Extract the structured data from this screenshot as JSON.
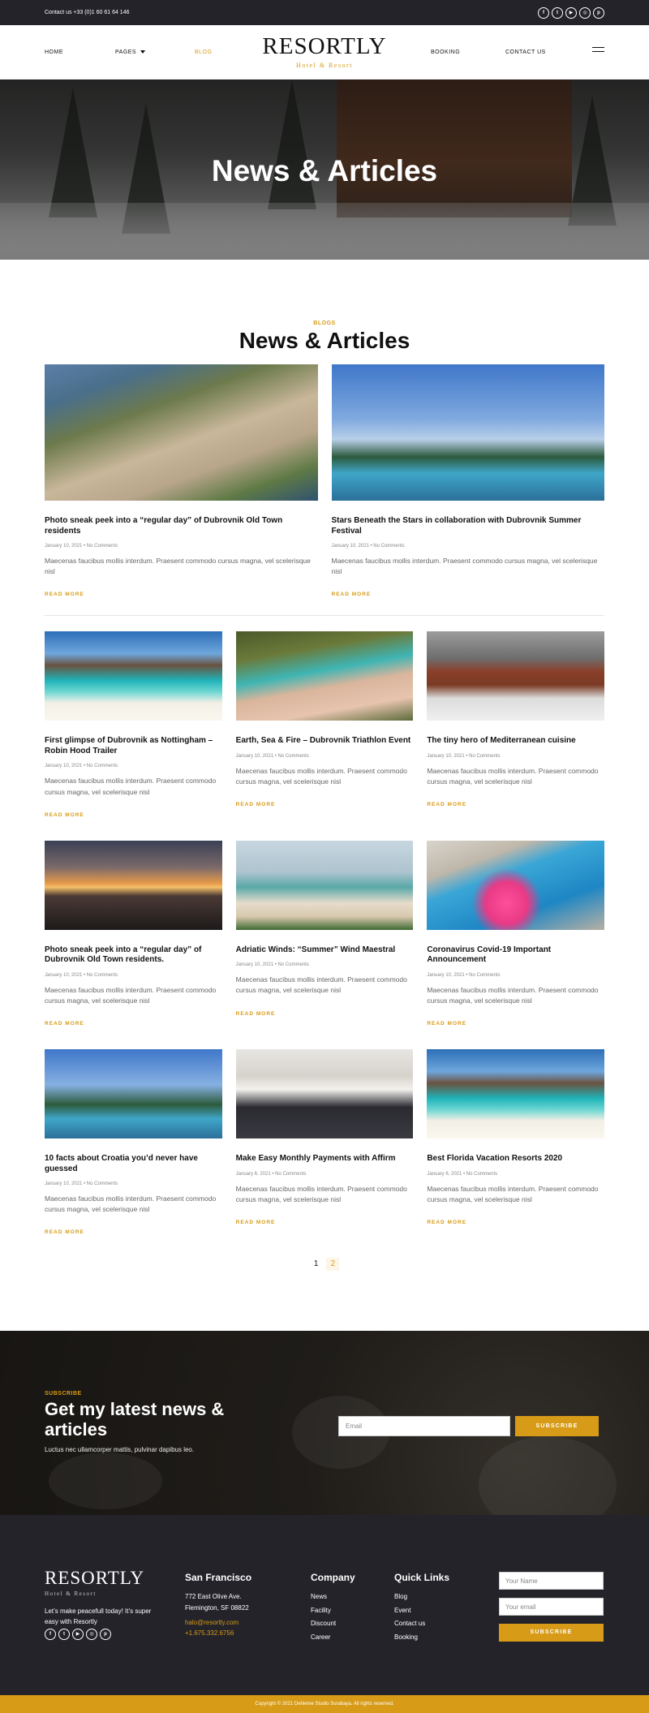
{
  "topbar": {
    "contact": "Contact us +33 (0)1 60 61 64 146",
    "social": [
      "facebook-icon",
      "twitter-icon",
      "youtube-icon",
      "instagram-icon",
      "pinterest-icon"
    ]
  },
  "nav": {
    "home": "HOME",
    "pages": "PAGES",
    "blog": "BLOG",
    "booking": "BOOKING",
    "contact": "CONTACT US"
  },
  "logo": {
    "name": "RESORTLY",
    "tagline": "Hotel & Resort"
  },
  "hero": {
    "title": "News & Articles"
  },
  "section": {
    "kicker": "BLOGS",
    "title": "News & Articles"
  },
  "featured": [
    {
      "title": "Photo sneak peek into a “regular day” of Dubrovnik Old Town residents",
      "meta": "January 10, 2021 • No Comments",
      "excerpt": "Maecenas faucibus mollis interdum. Praesent commodo cursus magna, vel scelerisque nisl",
      "more": "READ MORE"
    },
    {
      "title": "Stars Beneath the Stars in collaboration with Dubrovnik Summer Festival",
      "meta": "January 10, 2021 • No Comments",
      "excerpt": "Maecenas faucibus mollis interdum. Praesent commodo cursus magna, vel scelerisque nisl",
      "more": "READ MORE"
    }
  ],
  "posts": [
    {
      "title": "First glimpse of Dubrovnik as Nottingham – Robin Hood Trailer",
      "meta": "January 10, 2021 • No Comments",
      "excerpt": "Maecenas faucibus mollis interdum. Praesent commodo cursus magna, vel scelerisque nisl",
      "more": "READ MORE"
    },
    {
      "title": "Earth, Sea & Fire – Dubrovnik Triathlon Event",
      "meta": "January 10, 2021 • No Comments",
      "excerpt": "Maecenas faucibus mollis interdum. Praesent commodo cursus magna, vel scelerisque nisl",
      "more": "READ MORE"
    },
    {
      "title": "The tiny hero of Mediterranean cuisine",
      "meta": "January 10, 2021 • No Comments",
      "excerpt": "Maecenas faucibus mollis interdum. Praesent commodo cursus magna, vel scelerisque nisl",
      "more": "READ MORE"
    },
    {
      "title": "Photo sneak peek into a “regular day” of Dubrovnik Old Town residents.",
      "meta": "January 10, 2021 • No Comments",
      "excerpt": "Maecenas faucibus mollis interdum. Praesent commodo cursus magna, vel scelerisque nisl",
      "more": "READ MORE"
    },
    {
      "title": "Adriatic Winds: “Summer” Wind Maestral",
      "meta": "January 10, 2021 • No Comments",
      "excerpt": "Maecenas faucibus mollis interdum. Praesent commodo cursus magna, vel scelerisque nisl",
      "more": "READ MORE"
    },
    {
      "title": "Coronavirus Covid-19 Important Announcement",
      "meta": "January 10, 2021 • No Comments",
      "excerpt": "Maecenas faucibus mollis interdum. Praesent commodo cursus magna, vel scelerisque nisl",
      "more": "READ MORE"
    },
    {
      "title": "10 facts about Croatia you’d never have guessed",
      "meta": "January 10, 2021 • No Comments",
      "excerpt": "Maecenas faucibus mollis interdum. Praesent commodo cursus magna, vel scelerisque nisl",
      "more": "READ MORE"
    },
    {
      "title": "Make Easy Monthly Payments with Affirm",
      "meta": "January 6, 2021 • No Comments",
      "excerpt": "Maecenas faucibus mollis interdum. Praesent commodo cursus magna, vel scelerisque nisl",
      "more": "READ MORE"
    },
    {
      "title": "Best Florida Vacation Resorts 2020",
      "meta": "January 6, 2021 • No Comments",
      "excerpt": "Maecenas faucibus mollis interdum. Praesent commodo cursus magna, vel scelerisque nisl",
      "more": "READ MORE"
    }
  ],
  "pagination": {
    "current": "1",
    "next": "2"
  },
  "subscribe": {
    "kicker": "SUBSCRIBE",
    "title": "Get my latest news & articles",
    "text": "Luctus nec ullamcorper mattis, pulvinar dapibus leo.",
    "placeholder": "Email",
    "button": "SUBSCRIBE"
  },
  "footer": {
    "desc": "Let’s make peacefull today! It’s super easy with Resortly",
    "city": "San Francisco",
    "address1": "772 East Olive Ave.",
    "address2": "Flemington, SF 08822",
    "email": "halo@resortly.com",
    "phone": "+1.675.332.6756",
    "company_title": "Company",
    "company": [
      "News",
      "Facility",
      "Discount",
      "Career"
    ],
    "links_title": "Quick Links",
    "links": [
      "Blog",
      "Event",
      "Contact us",
      "Booking"
    ],
    "name_placeholder": "Your Name",
    "email_placeholder": "Your email",
    "button": "SUBSCRIBE",
    "copyright": "Copyright © 2021 Dehleme Studio Surabaya. All rights reserved."
  },
  "colors": {
    "accent": "#d79b17",
    "dark": "#24232a"
  }
}
